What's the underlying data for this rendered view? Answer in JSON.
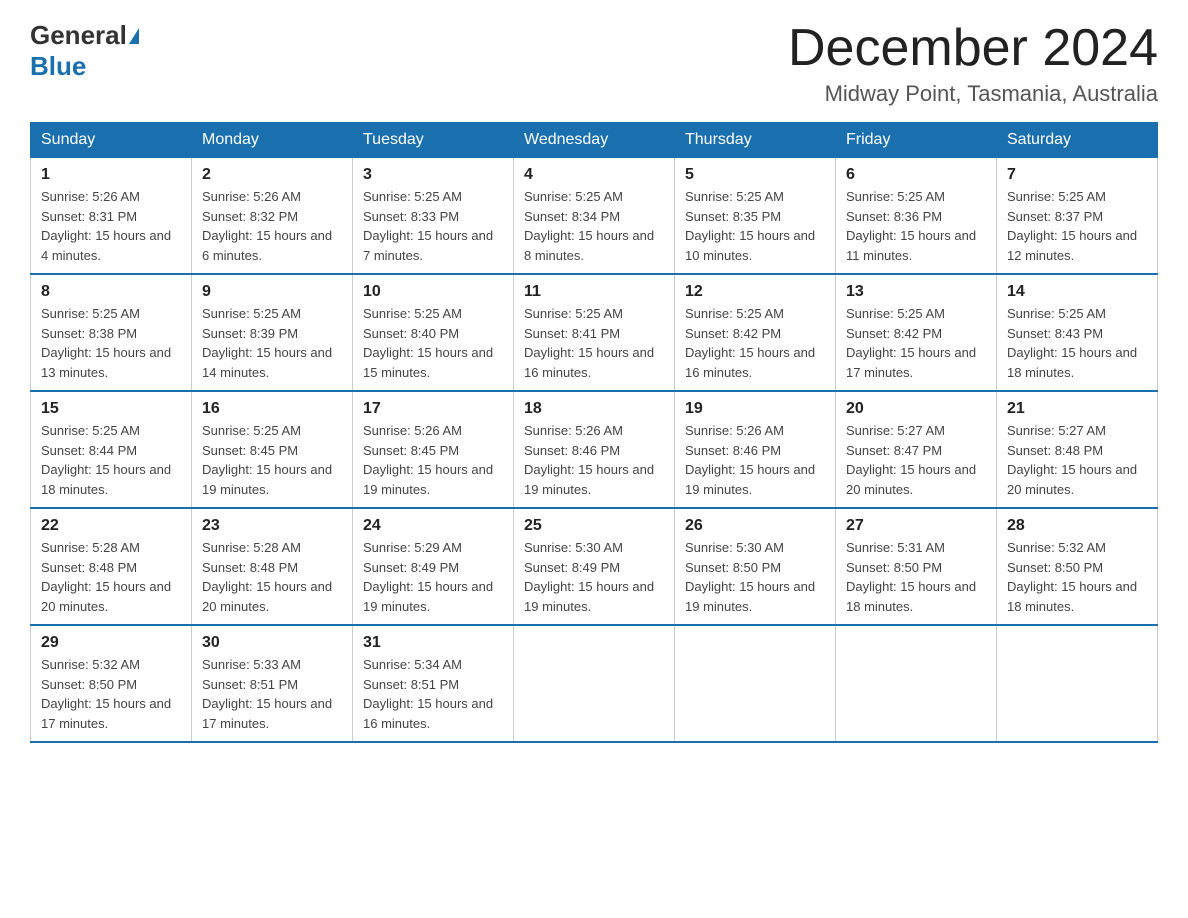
{
  "header": {
    "logo_general": "General",
    "logo_blue": "Blue",
    "month_title": "December 2024",
    "location": "Midway Point, Tasmania, Australia"
  },
  "weekdays": [
    "Sunday",
    "Monday",
    "Tuesday",
    "Wednesday",
    "Thursday",
    "Friday",
    "Saturday"
  ],
  "weeks": [
    [
      {
        "day": "1",
        "sunrise": "5:26 AM",
        "sunset": "8:31 PM",
        "daylight": "15 hours and 4 minutes."
      },
      {
        "day": "2",
        "sunrise": "5:26 AM",
        "sunset": "8:32 PM",
        "daylight": "15 hours and 6 minutes."
      },
      {
        "day": "3",
        "sunrise": "5:25 AM",
        "sunset": "8:33 PM",
        "daylight": "15 hours and 7 minutes."
      },
      {
        "day": "4",
        "sunrise": "5:25 AM",
        "sunset": "8:34 PM",
        "daylight": "15 hours and 8 minutes."
      },
      {
        "day": "5",
        "sunrise": "5:25 AM",
        "sunset": "8:35 PM",
        "daylight": "15 hours and 10 minutes."
      },
      {
        "day": "6",
        "sunrise": "5:25 AM",
        "sunset": "8:36 PM",
        "daylight": "15 hours and 11 minutes."
      },
      {
        "day": "7",
        "sunrise": "5:25 AM",
        "sunset": "8:37 PM",
        "daylight": "15 hours and 12 minutes."
      }
    ],
    [
      {
        "day": "8",
        "sunrise": "5:25 AM",
        "sunset": "8:38 PM",
        "daylight": "15 hours and 13 minutes."
      },
      {
        "day": "9",
        "sunrise": "5:25 AM",
        "sunset": "8:39 PM",
        "daylight": "15 hours and 14 minutes."
      },
      {
        "day": "10",
        "sunrise": "5:25 AM",
        "sunset": "8:40 PM",
        "daylight": "15 hours and 15 minutes."
      },
      {
        "day": "11",
        "sunrise": "5:25 AM",
        "sunset": "8:41 PM",
        "daylight": "15 hours and 16 minutes."
      },
      {
        "day": "12",
        "sunrise": "5:25 AM",
        "sunset": "8:42 PM",
        "daylight": "15 hours and 16 minutes."
      },
      {
        "day": "13",
        "sunrise": "5:25 AM",
        "sunset": "8:42 PM",
        "daylight": "15 hours and 17 minutes."
      },
      {
        "day": "14",
        "sunrise": "5:25 AM",
        "sunset": "8:43 PM",
        "daylight": "15 hours and 18 minutes."
      }
    ],
    [
      {
        "day": "15",
        "sunrise": "5:25 AM",
        "sunset": "8:44 PM",
        "daylight": "15 hours and 18 minutes."
      },
      {
        "day": "16",
        "sunrise": "5:25 AM",
        "sunset": "8:45 PM",
        "daylight": "15 hours and 19 minutes."
      },
      {
        "day": "17",
        "sunrise": "5:26 AM",
        "sunset": "8:45 PM",
        "daylight": "15 hours and 19 minutes."
      },
      {
        "day": "18",
        "sunrise": "5:26 AM",
        "sunset": "8:46 PM",
        "daylight": "15 hours and 19 minutes."
      },
      {
        "day": "19",
        "sunrise": "5:26 AM",
        "sunset": "8:46 PM",
        "daylight": "15 hours and 19 minutes."
      },
      {
        "day": "20",
        "sunrise": "5:27 AM",
        "sunset": "8:47 PM",
        "daylight": "15 hours and 20 minutes."
      },
      {
        "day": "21",
        "sunrise": "5:27 AM",
        "sunset": "8:48 PM",
        "daylight": "15 hours and 20 minutes."
      }
    ],
    [
      {
        "day": "22",
        "sunrise": "5:28 AM",
        "sunset": "8:48 PM",
        "daylight": "15 hours and 20 minutes."
      },
      {
        "day": "23",
        "sunrise": "5:28 AM",
        "sunset": "8:48 PM",
        "daylight": "15 hours and 20 minutes."
      },
      {
        "day": "24",
        "sunrise": "5:29 AM",
        "sunset": "8:49 PM",
        "daylight": "15 hours and 19 minutes."
      },
      {
        "day": "25",
        "sunrise": "5:30 AM",
        "sunset": "8:49 PM",
        "daylight": "15 hours and 19 minutes."
      },
      {
        "day": "26",
        "sunrise": "5:30 AM",
        "sunset": "8:50 PM",
        "daylight": "15 hours and 19 minutes."
      },
      {
        "day": "27",
        "sunrise": "5:31 AM",
        "sunset": "8:50 PM",
        "daylight": "15 hours and 18 minutes."
      },
      {
        "day": "28",
        "sunrise": "5:32 AM",
        "sunset": "8:50 PM",
        "daylight": "15 hours and 18 minutes."
      }
    ],
    [
      {
        "day": "29",
        "sunrise": "5:32 AM",
        "sunset": "8:50 PM",
        "daylight": "15 hours and 17 minutes."
      },
      {
        "day": "30",
        "sunrise": "5:33 AM",
        "sunset": "8:51 PM",
        "daylight": "15 hours and 17 minutes."
      },
      {
        "day": "31",
        "sunrise": "5:34 AM",
        "sunset": "8:51 PM",
        "daylight": "15 hours and 16 minutes."
      },
      null,
      null,
      null,
      null
    ]
  ]
}
